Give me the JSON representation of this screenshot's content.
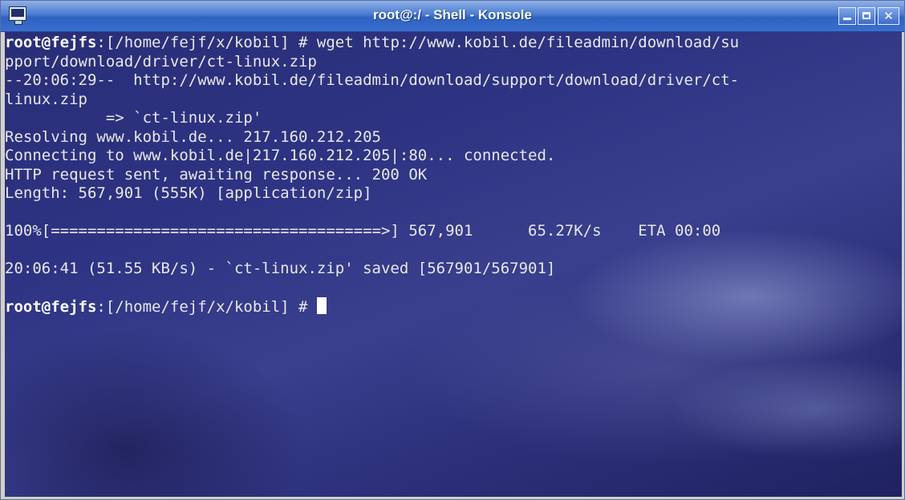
{
  "window": {
    "title": "root@:/ - Shell - Konsole",
    "buttons": {
      "minimize": "minimize",
      "maximize": "maximize",
      "close": "✕"
    },
    "icon": "terminal-icon"
  },
  "colors": {
    "titlebar": "#3a6fd0",
    "terminal_bg": "#2d3382",
    "text": "#e8e8e8"
  },
  "terminal": {
    "prompt_host": "root@fejfs",
    "lines": [
      {
        "prompt": "root@fejfs",
        "rest": ":[/home/fejf/x/kobil] # wget http://www.kobil.de/fileadmin/download/su"
      },
      {
        "text": "pport/download/driver/ct-linux.zip"
      },
      {
        "text": "--20:06:29--  http://www.kobil.de/fileadmin/download/support/download/driver/ct-"
      },
      {
        "text": "linux.zip"
      },
      {
        "text": "           => `ct-linux.zip'"
      },
      {
        "text": "Resolving www.kobil.de... 217.160.212.205"
      },
      {
        "text": "Connecting to www.kobil.de|217.160.212.205|:80... connected."
      },
      {
        "text": "HTTP request sent, awaiting response... 200 OK"
      },
      {
        "text": "Length: 567,901 (555K) [application/zip]"
      },
      {
        "text": ""
      },
      {
        "text": "100%[====================================>] 567,901      65.27K/s    ETA 00:00"
      },
      {
        "text": ""
      },
      {
        "text": "20:06:41 (51.55 KB/s) - `ct-linux.zip' saved [567901/567901]"
      },
      {
        "text": ""
      },
      {
        "prompt": "root@fejfs",
        "rest": ":[/home/fejf/x/kobil] # ",
        "cursor": true
      }
    ]
  }
}
